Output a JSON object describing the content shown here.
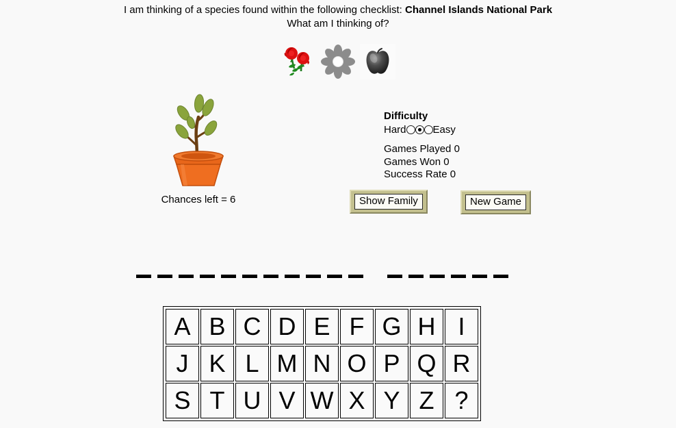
{
  "prompt": {
    "line1_prefix": "I am thinking of a species found within the following checklist: ",
    "checklist_name": "Channel Islands National Park",
    "line2": "What am I thinking of?"
  },
  "icons": [
    {
      "name": "red-roses-icon",
      "label": "Red roses"
    },
    {
      "name": "gray-daisy-flower-icon",
      "label": "Gray daisy flower"
    },
    {
      "name": "dark-apple-icon",
      "label": "Dark apple"
    }
  ],
  "hangman": {
    "graphic_name": "potted-sapling-plant",
    "chances_left_label": "Chances left = 6",
    "chances_left_value": 6,
    "stage": 0
  },
  "info_panel": {
    "difficulty_title": "Difficulty",
    "hard_label": "Hard",
    "easy_label": "Easy",
    "difficulty_options": [
      "hard",
      "medium",
      "easy"
    ],
    "difficulty_selected_index": 1,
    "stats": [
      {
        "label": "Games Played",
        "value": "0"
      },
      {
        "label": "Games Won",
        "value": "0"
      },
      {
        "label": "Success Rate",
        "value": "0"
      }
    ]
  },
  "buttons": {
    "show_family": "Show Family",
    "new_game": "New Game"
  },
  "word": {
    "words": [
      {
        "length": 11,
        "revealed": [
          "",
          "",
          "",
          "",
          "",
          "",
          "",
          "",
          "",
          "",
          ""
        ]
      },
      {
        "length": 6,
        "revealed": [
          "",
          "",
          "",
          "",
          "",
          ""
        ]
      }
    ]
  },
  "alphabet": {
    "rows": [
      [
        "A",
        "B",
        "C",
        "D",
        "E",
        "F",
        "G",
        "H",
        "I"
      ],
      [
        "J",
        "K",
        "L",
        "M",
        "N",
        "O",
        "P",
        "Q",
        "R"
      ],
      [
        "S",
        "T",
        "U",
        "V",
        "W",
        "X",
        "Y",
        "Z",
        "?"
      ]
    ]
  },
  "colors": {
    "background": "#f9f9f9",
    "text": "#000000",
    "button_bevel": "#c3c08e",
    "button_face": "#fbfbf5",
    "pot_orange": "#e8661a",
    "leaf_green": "#8aa43c",
    "stem_brown": "#6b3f12",
    "rose_red": "#dd1111",
    "daisy_gray": "#808080"
  }
}
